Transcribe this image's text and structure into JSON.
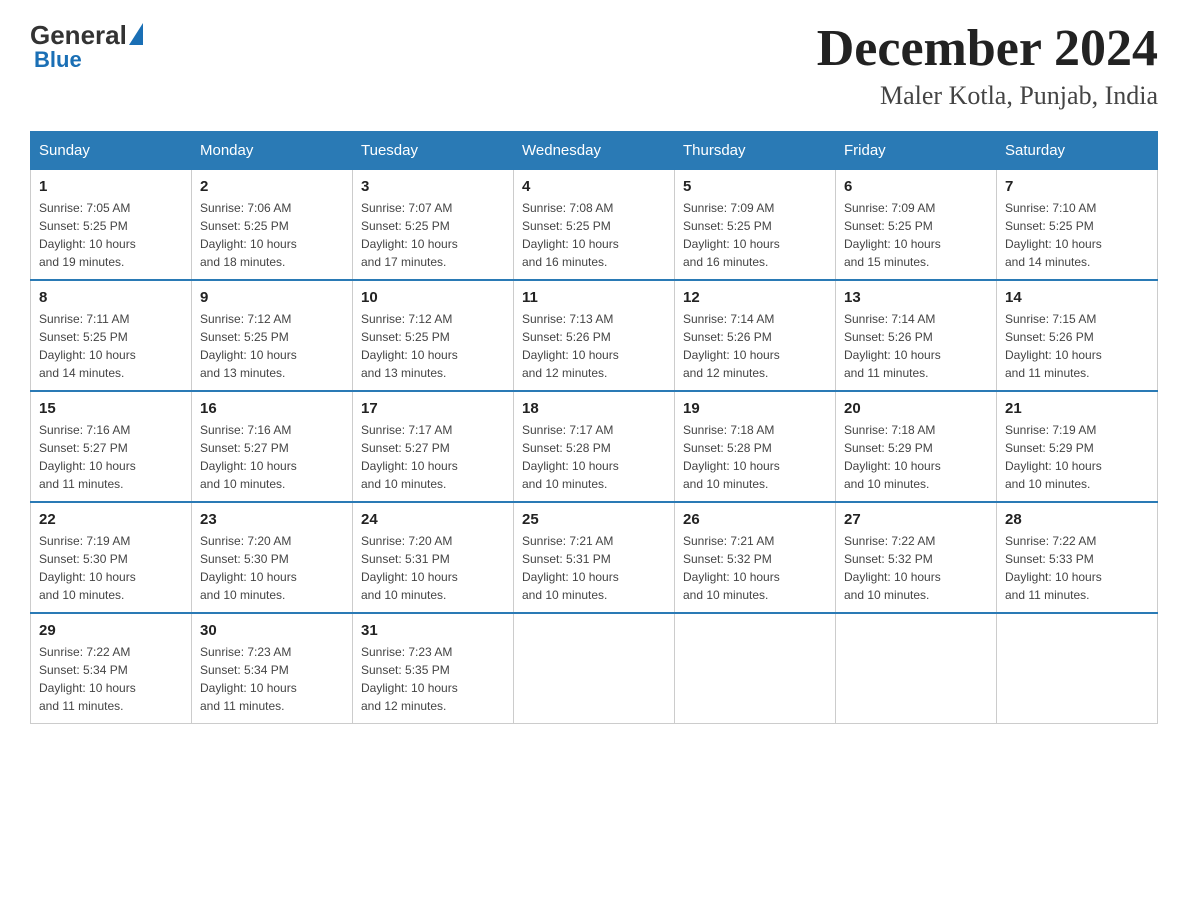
{
  "header": {
    "logo": {
      "general": "General",
      "blue": "Blue"
    },
    "title": "December 2024",
    "location": "Maler Kotla, Punjab, India"
  },
  "calendar": {
    "days_of_week": [
      "Sunday",
      "Monday",
      "Tuesday",
      "Wednesday",
      "Thursday",
      "Friday",
      "Saturday"
    ],
    "weeks": [
      [
        {
          "day": "1",
          "sunrise": "7:05 AM",
          "sunset": "5:25 PM",
          "daylight": "10 hours and 19 minutes."
        },
        {
          "day": "2",
          "sunrise": "7:06 AM",
          "sunset": "5:25 PM",
          "daylight": "10 hours and 18 minutes."
        },
        {
          "day": "3",
          "sunrise": "7:07 AM",
          "sunset": "5:25 PM",
          "daylight": "10 hours and 17 minutes."
        },
        {
          "day": "4",
          "sunrise": "7:08 AM",
          "sunset": "5:25 PM",
          "daylight": "10 hours and 16 minutes."
        },
        {
          "day": "5",
          "sunrise": "7:09 AM",
          "sunset": "5:25 PM",
          "daylight": "10 hours and 16 minutes."
        },
        {
          "day": "6",
          "sunrise": "7:09 AM",
          "sunset": "5:25 PM",
          "daylight": "10 hours and 15 minutes."
        },
        {
          "day": "7",
          "sunrise": "7:10 AM",
          "sunset": "5:25 PM",
          "daylight": "10 hours and 14 minutes."
        }
      ],
      [
        {
          "day": "8",
          "sunrise": "7:11 AM",
          "sunset": "5:25 PM",
          "daylight": "10 hours and 14 minutes."
        },
        {
          "day": "9",
          "sunrise": "7:12 AM",
          "sunset": "5:25 PM",
          "daylight": "10 hours and 13 minutes."
        },
        {
          "day": "10",
          "sunrise": "7:12 AM",
          "sunset": "5:25 PM",
          "daylight": "10 hours and 13 minutes."
        },
        {
          "day": "11",
          "sunrise": "7:13 AM",
          "sunset": "5:26 PM",
          "daylight": "10 hours and 12 minutes."
        },
        {
          "day": "12",
          "sunrise": "7:14 AM",
          "sunset": "5:26 PM",
          "daylight": "10 hours and 12 minutes."
        },
        {
          "day": "13",
          "sunrise": "7:14 AM",
          "sunset": "5:26 PM",
          "daylight": "10 hours and 11 minutes."
        },
        {
          "day": "14",
          "sunrise": "7:15 AM",
          "sunset": "5:26 PM",
          "daylight": "10 hours and 11 minutes."
        }
      ],
      [
        {
          "day": "15",
          "sunrise": "7:16 AM",
          "sunset": "5:27 PM",
          "daylight": "10 hours and 11 minutes."
        },
        {
          "day": "16",
          "sunrise": "7:16 AM",
          "sunset": "5:27 PM",
          "daylight": "10 hours and 10 minutes."
        },
        {
          "day": "17",
          "sunrise": "7:17 AM",
          "sunset": "5:27 PM",
          "daylight": "10 hours and 10 minutes."
        },
        {
          "day": "18",
          "sunrise": "7:17 AM",
          "sunset": "5:28 PM",
          "daylight": "10 hours and 10 minutes."
        },
        {
          "day": "19",
          "sunrise": "7:18 AM",
          "sunset": "5:28 PM",
          "daylight": "10 hours and 10 minutes."
        },
        {
          "day": "20",
          "sunrise": "7:18 AM",
          "sunset": "5:29 PM",
          "daylight": "10 hours and 10 minutes."
        },
        {
          "day": "21",
          "sunrise": "7:19 AM",
          "sunset": "5:29 PM",
          "daylight": "10 hours and 10 minutes."
        }
      ],
      [
        {
          "day": "22",
          "sunrise": "7:19 AM",
          "sunset": "5:30 PM",
          "daylight": "10 hours and 10 minutes."
        },
        {
          "day": "23",
          "sunrise": "7:20 AM",
          "sunset": "5:30 PM",
          "daylight": "10 hours and 10 minutes."
        },
        {
          "day": "24",
          "sunrise": "7:20 AM",
          "sunset": "5:31 PM",
          "daylight": "10 hours and 10 minutes."
        },
        {
          "day": "25",
          "sunrise": "7:21 AM",
          "sunset": "5:31 PM",
          "daylight": "10 hours and 10 minutes."
        },
        {
          "day": "26",
          "sunrise": "7:21 AM",
          "sunset": "5:32 PM",
          "daylight": "10 hours and 10 minutes."
        },
        {
          "day": "27",
          "sunrise": "7:22 AM",
          "sunset": "5:32 PM",
          "daylight": "10 hours and 10 minutes."
        },
        {
          "day": "28",
          "sunrise": "7:22 AM",
          "sunset": "5:33 PM",
          "daylight": "10 hours and 11 minutes."
        }
      ],
      [
        {
          "day": "29",
          "sunrise": "7:22 AM",
          "sunset": "5:34 PM",
          "daylight": "10 hours and 11 minutes."
        },
        {
          "day": "30",
          "sunrise": "7:23 AM",
          "sunset": "5:34 PM",
          "daylight": "10 hours and 11 minutes."
        },
        {
          "day": "31",
          "sunrise": "7:23 AM",
          "sunset": "5:35 PM",
          "daylight": "10 hours and 12 minutes."
        },
        null,
        null,
        null,
        null
      ]
    ],
    "labels": {
      "sunrise": "Sunrise:",
      "sunset": "Sunset:",
      "daylight": "Daylight:"
    }
  }
}
